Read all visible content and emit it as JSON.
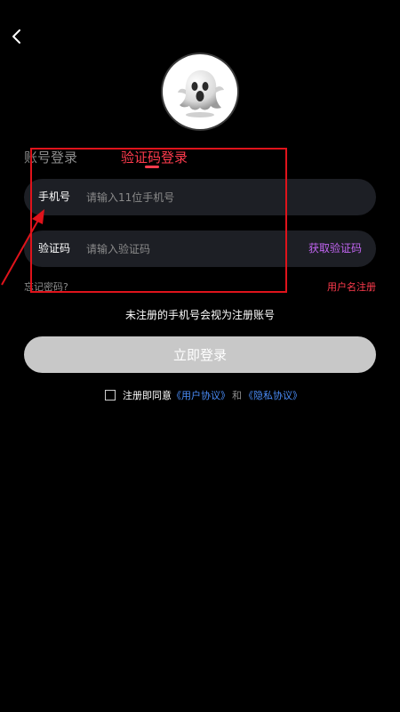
{
  "header": {
    "back_icon": "chevron-left-icon",
    "avatar_icon": "ghost-avatar"
  },
  "tabs": [
    {
      "label": "账号登录",
      "active": false
    },
    {
      "label": "验证码登录",
      "active": true
    }
  ],
  "phone_field": {
    "label": "手机号",
    "placeholder": "请输入11位手机号",
    "value": ""
  },
  "code_field": {
    "label": "验证码",
    "placeholder": "请输入验证码",
    "value": "",
    "get_code_label": "获取验证码"
  },
  "links": {
    "forgot_password": "忘记密码?",
    "username_register": "用户名注册"
  },
  "notice": "未注册的手机号会视为注册账号",
  "login_button": "立即登录",
  "agreement": {
    "checked": false,
    "prefix": "注册即同意",
    "user_agreement": "《用户协议》",
    "and": "和",
    "privacy_agreement": "《隐私协议》"
  },
  "colors": {
    "background": "#000000",
    "accent_red": "#ff3b4d",
    "accent_purple": "#c064f0",
    "link_blue": "#4a8cf7",
    "input_bg": "#1d1f25",
    "button_disabled": "#c8c8c8",
    "annotation_red": "#e0131b"
  }
}
